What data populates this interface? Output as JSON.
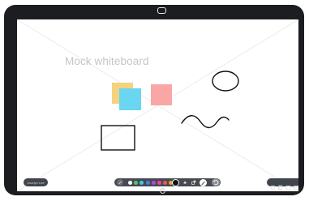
{
  "whiteboard": {
    "title": "Mock whiteboard"
  },
  "user": {
    "label": "Jocelyn Lee"
  },
  "toolbar": {
    "colors": [
      {
        "name": "white",
        "hex": "#ffffff"
      },
      {
        "name": "green",
        "hex": "#56c271"
      },
      {
        "name": "cyan",
        "hex": "#3ad1e6"
      },
      {
        "name": "blue",
        "hex": "#4a7cf0"
      },
      {
        "name": "purple",
        "hex": "#b24fd8"
      },
      {
        "name": "magenta",
        "hex": "#f0459b"
      },
      {
        "name": "red",
        "hex": "#f2555a"
      },
      {
        "name": "orange",
        "hex": "#f5a32b"
      },
      {
        "name": "black",
        "hex": "#111111"
      }
    ],
    "selected_color": "black",
    "tools": [
      "pen-icon",
      "eraser-icon",
      "shapes-icon",
      "marker-icon",
      "undo-icon"
    ],
    "right_icons": [
      "trash-icon",
      "copy-icon",
      "fullscreen-icon",
      "share-icon"
    ]
  }
}
